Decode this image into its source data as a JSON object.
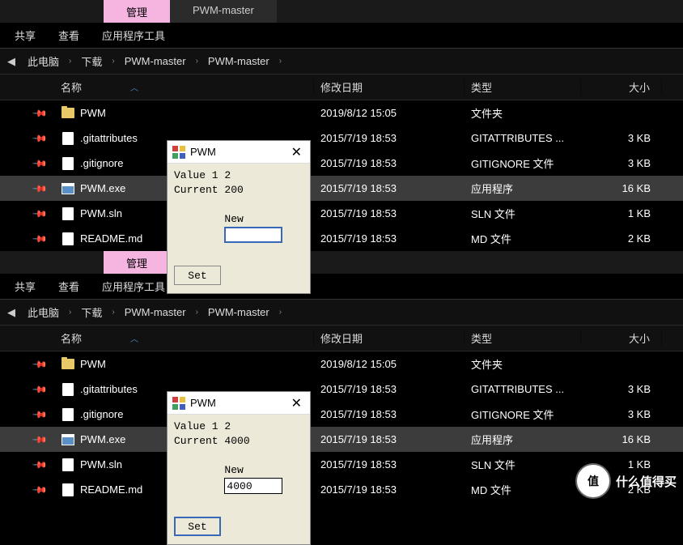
{
  "tabs": {
    "manage": "管理",
    "title": "PWM-master"
  },
  "ribbon": {
    "share": "共享",
    "view": "查看",
    "tools": "应用程序工具"
  },
  "breadcrumb": [
    "此电脑",
    "下载",
    "PWM-master",
    "PWM-master"
  ],
  "headers": {
    "name": "名称",
    "date": "修改日期",
    "type": "类型",
    "size": "大小"
  },
  "files": [
    {
      "icon": "folder",
      "name": "PWM",
      "date": "2019/8/12 15:05",
      "type": "文件夹",
      "size": ""
    },
    {
      "icon": "file",
      "name": ".gitattributes",
      "date": "2015/7/19 18:53",
      "type": "GITATTRIBUTES ...",
      "size": "3 KB"
    },
    {
      "icon": "file",
      "name": ".gitignore",
      "date": "2015/7/19 18:53",
      "type": "GITIGNORE 文件",
      "size": "3 KB"
    },
    {
      "icon": "exe",
      "name": "PWM.exe",
      "date": "2015/7/19 18:53",
      "type": "应用程序",
      "size": "16 KB",
      "selected": true
    },
    {
      "icon": "file",
      "name": "PWM.sln",
      "date": "2015/7/19 18:53",
      "type": "SLN 文件",
      "size": "1 KB"
    },
    {
      "icon": "file",
      "name": "README.md",
      "date": "2015/7/19 18:53",
      "type": "MD 文件",
      "size": "2 KB"
    }
  ],
  "pwm_top": {
    "title": "PWM",
    "line1": "Value 1 2",
    "line2": "Current 200",
    "new_label": "New",
    "new_value": "",
    "btn": "Set"
  },
  "pwm_bot": {
    "title": "PWM",
    "line1": "Value 1 2",
    "line2": "Current 4000",
    "new_label": "New",
    "new_value": "4000",
    "btn": "Set"
  },
  "watermark": {
    "badge": "值",
    "text": "什么值得买"
  }
}
